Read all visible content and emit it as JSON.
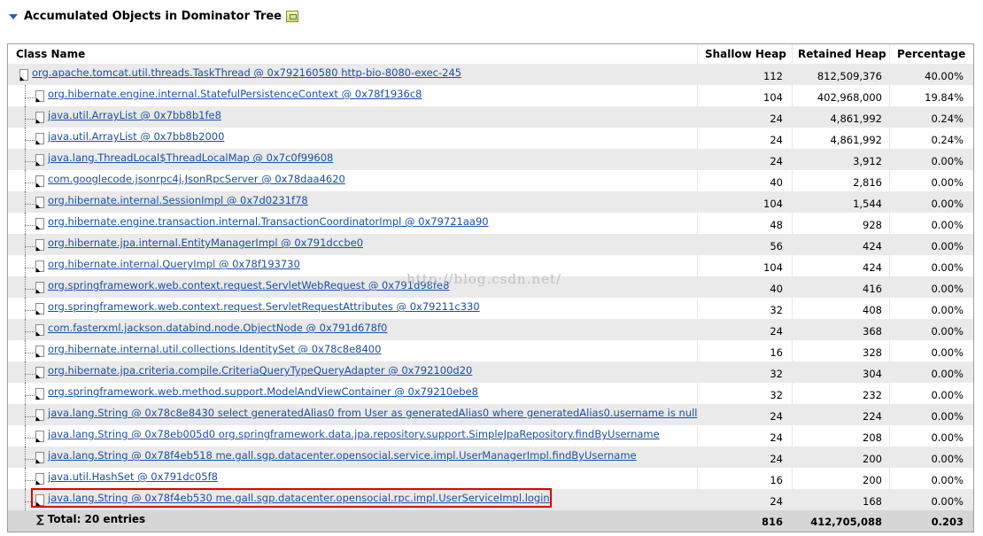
{
  "section": {
    "title": "Accumulated Objects in Dominator Tree"
  },
  "columns": [
    "Class Name",
    "Shallow Heap",
    "Retained Heap",
    "Percentage"
  ],
  "rows": [
    {
      "name": "org.apache.tomcat.util.threads.TaskThread @ 0x792160580 http-bio-8080-exec-245",
      "shallow": "112",
      "retained": "812,509,376",
      "percent": "40.00%"
    },
    {
      "name": "org.hibernate.engine.internal.StatefulPersistenceContext @ 0x78f1936c8",
      "shallow": "104",
      "retained": "402,968,000",
      "percent": "19.84%"
    },
    {
      "name": "java.util.ArrayList @ 0x7bb8b1fe8",
      "shallow": "24",
      "retained": "4,861,992",
      "percent": "0.24%"
    },
    {
      "name": "java.util.ArrayList @ 0x7bb8b2000",
      "shallow": "24",
      "retained": "4,861,992",
      "percent": "0.24%"
    },
    {
      "name": "java.lang.ThreadLocal$ThreadLocalMap @ 0x7c0f99608",
      "shallow": "24",
      "retained": "3,912",
      "percent": "0.00%"
    },
    {
      "name": "com.googlecode.jsonrpc4j.JsonRpcServer @ 0x78daa4620",
      "shallow": "40",
      "retained": "2,816",
      "percent": "0.00%"
    },
    {
      "name": "org.hibernate.internal.SessionImpl @ 0x7d0231f78",
      "shallow": "104",
      "retained": "1,544",
      "percent": "0.00%"
    },
    {
      "name": "org.hibernate.engine.transaction.internal.TransactionCoordinatorImpl @ 0x79721aa90",
      "shallow": "48",
      "retained": "928",
      "percent": "0.00%"
    },
    {
      "name": "org.hibernate.jpa.internal.EntityManagerImpl @ 0x791dccbe0",
      "shallow": "56",
      "retained": "424",
      "percent": "0.00%"
    },
    {
      "name": "org.hibernate.internal.QueryImpl @ 0x78f193730",
      "shallow": "104",
      "retained": "424",
      "percent": "0.00%"
    },
    {
      "name": "org.springframework.web.context.request.ServletWebRequest @ 0x791d98fe8",
      "shallow": "40",
      "retained": "416",
      "percent": "0.00%"
    },
    {
      "name": "org.springframework.web.context.request.ServletRequestAttributes @ 0x79211c330",
      "shallow": "32",
      "retained": "408",
      "percent": "0.00%"
    },
    {
      "name": "com.fasterxml.jackson.databind.node.ObjectNode @ 0x791d678f0",
      "shallow": "24",
      "retained": "368",
      "percent": "0.00%"
    },
    {
      "name": "org.hibernate.internal.util.collections.IdentitySet @ 0x78c8e8400",
      "shallow": "16",
      "retained": "328",
      "percent": "0.00%"
    },
    {
      "name": "org.hibernate.jpa.criteria.compile.CriteriaQueryTypeQueryAdapter @ 0x792100d20",
      "shallow": "32",
      "retained": "304",
      "percent": "0.00%"
    },
    {
      "name": "org.springframework.web.method.support.ModelAndViewContainer @ 0x79210ebe8",
      "shallow": "32",
      "retained": "232",
      "percent": "0.00%"
    },
    {
      "name": "java.lang.String @ 0x78c8e8430 select generatedAlias0 from User as generatedAlias0 where generatedAlias0.username is null",
      "shallow": "24",
      "retained": "224",
      "percent": "0.00%"
    },
    {
      "name": "java.lang.String @ 0x78eb005d0 org.springframework.data.jpa.repository.support.SimpleJpaRepository.findByUsername",
      "shallow": "24",
      "retained": "208",
      "percent": "0.00%"
    },
    {
      "name": "java.lang.String @ 0x78f4eb518 me.gall.sgp.datacenter.opensocial.service.impl.UserManagerImpl.findByUsername",
      "shallow": "24",
      "retained": "200",
      "percent": "0.00%"
    },
    {
      "name": "java.util.HashSet @ 0x791dc05f8",
      "shallow": "16",
      "retained": "200",
      "percent": "0.00%"
    },
    {
      "name": "java.lang.String @ 0x78f4eb530 me.gall.sgp.datacenter.opensocial.rpc.impl.UserServiceImpl.login",
      "shallow": "24",
      "retained": "168",
      "percent": "0.00%"
    }
  ],
  "total": {
    "label": "∑ Total: 20 entries",
    "shallow": "816",
    "retained": "412,705,088",
    "percent": "0.203"
  },
  "watermark": "http://blog.csdn.net/"
}
